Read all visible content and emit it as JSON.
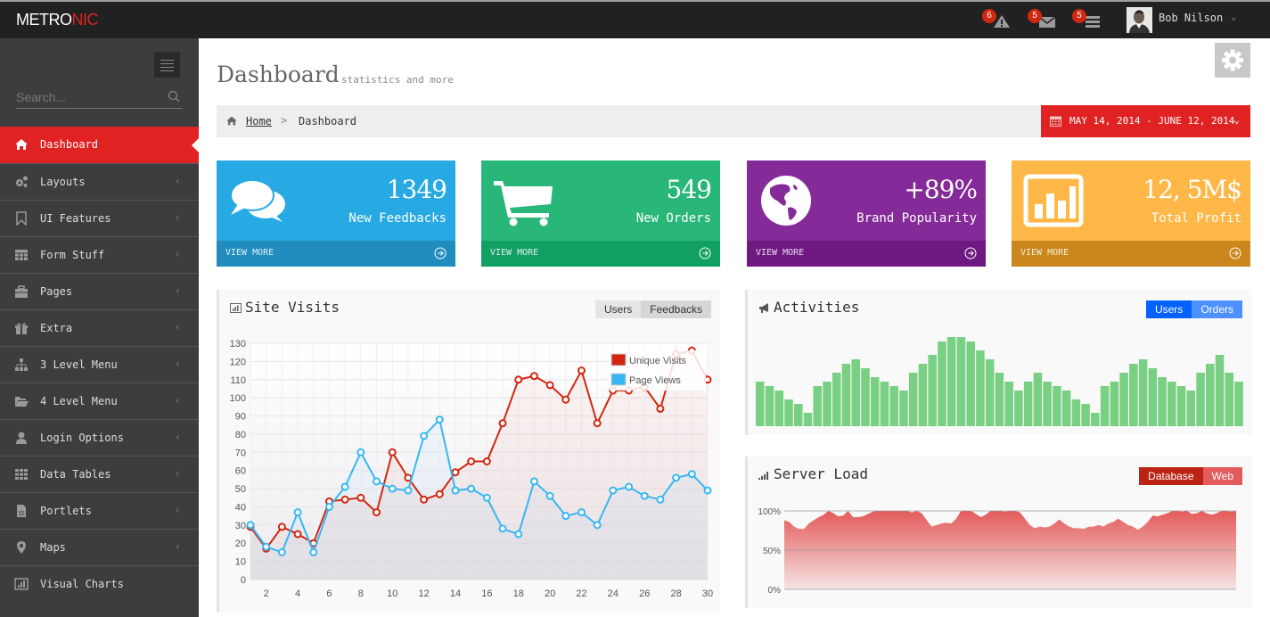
{
  "header": {
    "logo_main": "METRO",
    "logo_accent": "NIC",
    "notifications": [
      {
        "icon": "warning-icon",
        "count": "6"
      },
      {
        "icon": "envelope-icon",
        "count": "5"
      },
      {
        "icon": "tasks-icon",
        "count": "5"
      }
    ],
    "user_name": "Bob Nilson"
  },
  "sidebar": {
    "search_placeholder": "Search...",
    "items": [
      {
        "label": "Dashboard",
        "icon": "home-icon",
        "active": true
      },
      {
        "label": "Layouts",
        "icon": "cogs-icon"
      },
      {
        "label": "UI Features",
        "icon": "bookmark-icon"
      },
      {
        "label": "Form Stuff",
        "icon": "table-icon"
      },
      {
        "label": "Pages",
        "icon": "briefcase-icon"
      },
      {
        "label": "Extra",
        "icon": "gift-icon"
      },
      {
        "label": "3 Level Menu",
        "icon": "sitemap-icon"
      },
      {
        "label": "4 Level Menu",
        "icon": "folder-open-icon"
      },
      {
        "label": "Login Options",
        "icon": "user-icon"
      },
      {
        "label": "Data Tables",
        "icon": "th-icon"
      },
      {
        "label": "Portlets",
        "icon": "file-text-icon"
      },
      {
        "label": "Maps",
        "icon": "map-marker-icon"
      },
      {
        "label": "Visual Charts",
        "icon": "bar-chart-icon"
      }
    ]
  },
  "page": {
    "title": "Dashboard",
    "subtitle": "statistics and more",
    "breadcrumb": {
      "home": "Home",
      "separator": ">",
      "current": "Dashboard"
    },
    "date_range": "MAY 14, 2014 - JUNE 12, 2014"
  },
  "stats": [
    {
      "number": "1349",
      "desc": "New Feedbacks",
      "more": "VIEW MORE",
      "icon": "comments-icon",
      "color": "#27a9e3",
      "more_color": "#208dbe"
    },
    {
      "number": "549",
      "desc": "New Orders",
      "more": "VIEW MORE",
      "icon": "shopping-cart-icon",
      "color": "#28b779",
      "more_color": "#10a062"
    },
    {
      "number": "+89%",
      "desc": "Brand Popularity",
      "more": "VIEW MORE",
      "icon": "globe-icon",
      "color": "#852b99",
      "more_color": "#6e1881"
    },
    {
      "number": "12, 5M$",
      "desc": "Total Profit",
      "more": "VIEW MORE",
      "icon": "bar-chart-icon",
      "color": "#ffb848",
      "more_color": "#cb871b"
    }
  ],
  "site_visits": {
    "title": "Site Visits",
    "buttons": [
      "Users",
      "Feedbacks"
    ]
  },
  "activities": {
    "title": "Activities",
    "buttons": [
      "Users",
      "Orders"
    ]
  },
  "server_load": {
    "title": "Server Load",
    "buttons": [
      "Database",
      "Web"
    ]
  },
  "chart_data": [
    {
      "type": "line",
      "title": "Site Visits",
      "x": [
        1,
        2,
        3,
        4,
        5,
        6,
        7,
        8,
        9,
        10,
        11,
        12,
        13,
        14,
        15,
        16,
        17,
        18,
        19,
        20,
        21,
        22,
        23,
        24,
        25,
        26,
        27,
        28,
        29,
        30
      ],
      "xticks": [
        "2",
        "4",
        "6",
        "8",
        "10",
        "12",
        "14",
        "16",
        "18",
        "20",
        "22",
        "24",
        "26",
        "28",
        "30"
      ],
      "yticks": [
        "0",
        "10",
        "20",
        "30",
        "40",
        "50",
        "60",
        "70",
        "80",
        "90",
        "100",
        "110",
        "120",
        "130"
      ],
      "ylim": [
        0,
        130
      ],
      "xlim": [
        1,
        30
      ],
      "grid": true,
      "legend": "top-right",
      "series": [
        {
          "name": "Unique Visits",
          "color": "#d12610",
          "values": [
            29,
            17,
            29,
            25,
            20,
            43,
            44,
            45,
            37,
            70,
            56,
            44,
            47,
            59,
            65,
            65,
            86,
            110,
            112,
            107,
            99,
            115,
            86,
            104,
            104,
            106,
            94,
            124,
            126,
            110
          ]
        },
        {
          "name": "Page Views",
          "color": "#37b7f3",
          "values": [
            30,
            18,
            15,
            37,
            15,
            40,
            51,
            70,
            54,
            50,
            49,
            79,
            88,
            49,
            50,
            45,
            28,
            25,
            54,
            46,
            35,
            37,
            30,
            49,
            51,
            46,
            44,
            56,
            58,
            49
          ]
        }
      ]
    },
    {
      "type": "bar",
      "title": "Activities",
      "color": "#7ad082",
      "ylim": [
        0,
        20
      ],
      "values": [
        10,
        9,
        8,
        6,
        5,
        3,
        9,
        10,
        12,
        14,
        15,
        13,
        11,
        10,
        9,
        8,
        12,
        14,
        16,
        19,
        20,
        20,
        19,
        17,
        15,
        12,
        10,
        8,
        10,
        12,
        10,
        9,
        8,
        6,
        5,
        3,
        9,
        10,
        12,
        14,
        15,
        13,
        11,
        10,
        9,
        8,
        12,
        14,
        16,
        12,
        10
      ]
    },
    {
      "type": "area",
      "title": "Server Load",
      "color": "#e35b5a",
      "yticks": [
        "0%",
        "50%",
        "100%"
      ],
      "ylim": [
        0,
        100
      ],
      "values": [
        88,
        86,
        80,
        77,
        77,
        84,
        88,
        92,
        95,
        100,
        97,
        93,
        94,
        100,
        92,
        92,
        93,
        96,
        99,
        100,
        100,
        100,
        100,
        100,
        100,
        100,
        98,
        100,
        97,
        88,
        80,
        82,
        84,
        85,
        84,
        90,
        100,
        100,
        100,
        96,
        92,
        95,
        100,
        100,
        100,
        99,
        100,
        100,
        98,
        90,
        82,
        78,
        80,
        79,
        80,
        84,
        89,
        84,
        80,
        78,
        78,
        77,
        80,
        80,
        82,
        80,
        84,
        86,
        90,
        86,
        82,
        80,
        76,
        80,
        86,
        94,
        93,
        95,
        97,
        100,
        100,
        99,
        100,
        96,
        97,
        100,
        97,
        95,
        97,
        100,
        100,
        99,
        100
      ]
    }
  ]
}
